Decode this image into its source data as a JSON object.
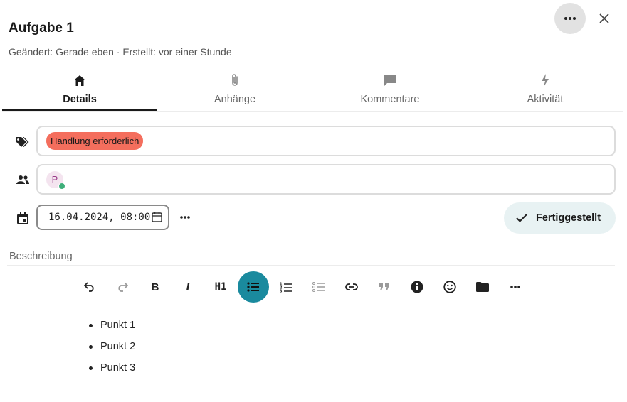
{
  "header": {
    "title": "Aufgabe 1",
    "meta": "Geändert: Gerade eben · Erstellt: vor einer Stunde",
    "more_icon": "more-horizontal-icon",
    "close_icon": "close-icon"
  },
  "tabs": [
    {
      "label": "Details",
      "icon": "home-icon",
      "active": true
    },
    {
      "label": "Anhänge",
      "icon": "paperclip-icon",
      "active": false
    },
    {
      "label": "Kommentare",
      "icon": "comment-icon",
      "active": false
    },
    {
      "label": "Aktivität",
      "icon": "lightning-icon",
      "active": false
    }
  ],
  "tags": {
    "icon": "tags-icon",
    "value": "Handlung erforderlich",
    "color": "#f46e5d"
  },
  "assignees": {
    "icon": "people-icon",
    "avatar_initial": "P",
    "status_color": "#3fae7a"
  },
  "due": {
    "icon": "calendar-icon",
    "value": "16.04.2024, 08:00",
    "done_label": "Fertiggestellt"
  },
  "description": {
    "label": "Beschreibung",
    "toolbar": [
      {
        "name": "undo",
        "icon": "undo-icon"
      },
      {
        "name": "redo",
        "icon": "redo-icon"
      },
      {
        "name": "bold",
        "label": "B"
      },
      {
        "name": "italic",
        "label": "I"
      },
      {
        "name": "heading1",
        "label": "H1"
      },
      {
        "name": "bullet-list",
        "icon": "bullet-list-icon",
        "active": true
      },
      {
        "name": "ordered-list",
        "icon": "ordered-list-icon"
      },
      {
        "name": "checklist",
        "icon": "checklist-icon"
      },
      {
        "name": "link",
        "icon": "link-icon"
      },
      {
        "name": "quote",
        "icon": "quote-icon"
      },
      {
        "name": "info",
        "icon": "info-icon"
      },
      {
        "name": "emoji",
        "icon": "emoji-icon"
      },
      {
        "name": "folder",
        "icon": "folder-icon"
      },
      {
        "name": "more",
        "icon": "more-horizontal-icon"
      }
    ],
    "items": [
      "Punkt 1",
      "Punkt 2",
      "Punkt 3"
    ]
  },
  "colors": {
    "accent": "#1a8a9e",
    "done_bg": "#e8f2f3"
  }
}
